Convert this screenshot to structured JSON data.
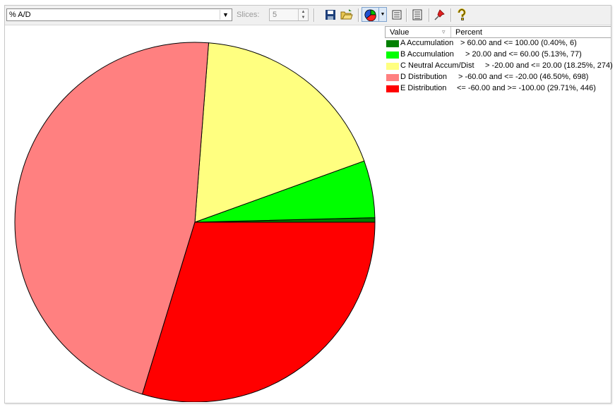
{
  "toolbar": {
    "metric": "% A/D",
    "slices_label": "Slices:",
    "slices_value": "5"
  },
  "legend": {
    "header_value": "Value",
    "header_percent": "Percent",
    "items": [
      {
        "name": "A Accumulation",
        "range": "> 60.00 and <= 100.00 (0.40%, 6)",
        "color": "#008000"
      },
      {
        "name": "B Accumulation",
        "range": "> 20.00 and <= 60.00 (5.13%, 77)",
        "color": "#00ff00"
      },
      {
        "name": "C Neutral Accum/Dist",
        "range": "> -20.00 and <= 20.00 (18.25%, 274)",
        "color": "#ffff80"
      },
      {
        "name": "D Distribution",
        "range": "> -60.00 and <= -20.00 (46.50%, 698)",
        "color": "#ff8080"
      },
      {
        "name": "E Distribution",
        "range": "<= -60.00 and >= -100.00 (29.71%, 446)",
        "color": "#ff0000"
      }
    ]
  },
  "chart_data": {
    "type": "pie",
    "categories": [
      "A Accumulation",
      "B Accumulation",
      "C Neutral Accum/Dist",
      "D Distribution",
      "E Distribution"
    ],
    "values": [
      0.4,
      5.13,
      18.25,
      46.5,
      29.71
    ],
    "counts": [
      6,
      77,
      274,
      698,
      446
    ],
    "colors": [
      "#008000",
      "#00ff00",
      "#ffff80",
      "#ff8080",
      "#ff0000"
    ],
    "legend": "right"
  }
}
